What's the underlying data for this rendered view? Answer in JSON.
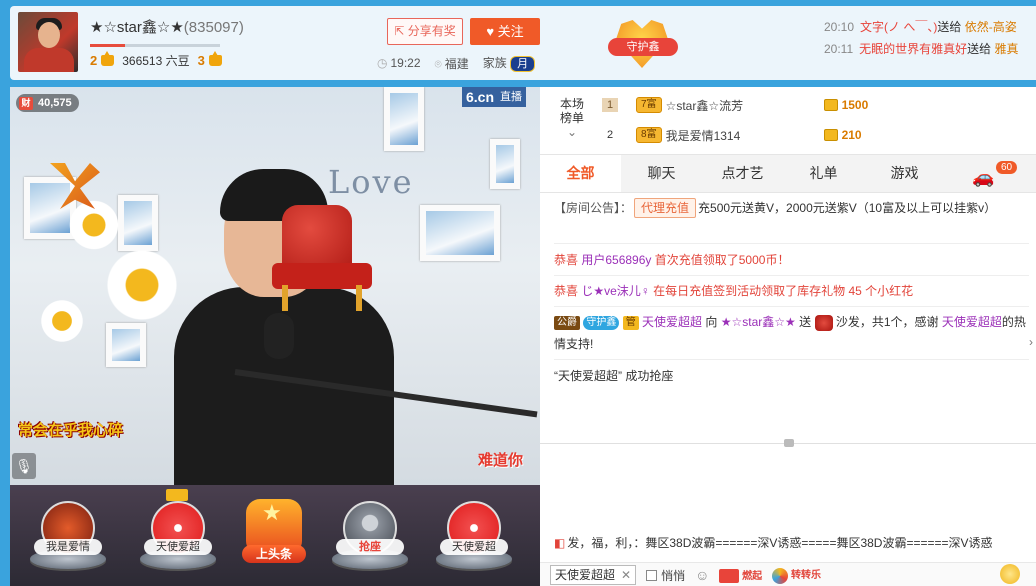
{
  "header": {
    "host_name": "★☆star鑫☆★",
    "host_id": "(835097)",
    "level_progress": 0.27,
    "level_left": "2",
    "beans": "366513 六豆",
    "level_right": "3",
    "share_label": "分享有奖",
    "follow_label": "关注",
    "time": "19:22",
    "location": "福建",
    "family_label": "家族",
    "family_badge": "月",
    "guard_label": "守护鑫"
  },
  "gift_log": [
    {
      "time": "20:10",
      "user": "文字(ノ へ￣、)",
      "action": "送给",
      "target": "依然-高姿"
    },
    {
      "time": "20:11",
      "user": "无眠的世界有雅真好",
      "action": "送给",
      "target": "雅真"
    }
  ],
  "video": {
    "wealth": "40,575",
    "wealth_tag": "财",
    "site": "6.cn",
    "live": "直播",
    "wall_text": "Love",
    "caption_left": "常会在乎我心碎",
    "caption_right": "难道你"
  },
  "seats": [
    {
      "label": "我是爱情"
    },
    {
      "label": "天使爱超"
    },
    {
      "label": "上头条"
    },
    {
      "label": "抢座"
    },
    {
      "label": "天使爱超"
    }
  ],
  "rank": {
    "title_line1": "本场",
    "title_line2": "榜单",
    "rows": [
      {
        "num": "1",
        "tag": "7富",
        "name": "☆star鑫☆流芳",
        "coins": "1500"
      },
      {
        "num": "2",
        "tag": "8富",
        "name": "我是爱情1314",
        "coins": "210"
      }
    ]
  },
  "tabs": [
    "全部",
    "聊天",
    "点才艺",
    "礼单",
    "游戏"
  ],
  "car_badge": "60",
  "chat": {
    "notice_prefix": "【房间公告】：",
    "notice_chip": "代理充值",
    "notice_text": "充500元送黄V，2000元送紫V（10富及以上可以挂紫v）",
    "congrats1_label": "恭喜",
    "congrats1_user": "用户656896y",
    "congrats1_text": "首次充值领取了5000币！",
    "congrats2_label": "恭喜",
    "congrats2_user": "じ★ve沫儿♀",
    "congrats2_text": "在每日充值签到活动领取了库存礼物 45 个小红花",
    "sofa_tag1": "公爵",
    "sofa_tag2": "守护鑫",
    "sofa_tag3": "管",
    "sofa_user": "天使爱超超",
    "sofa_to": "向",
    "sofa_host": "★☆star鑫☆★",
    "sofa_send": "送",
    "sofa_text": "沙发，共1个，感谢",
    "sofa_thanks_user": "天使爱超超",
    "sofa_tail": "的热情支持!",
    "seat_msg": "“天使爱超超” 成功抢座"
  },
  "ticker": "发，福，利，：舞区38D波霸======深V诱惑=====舞区38D波霸======深V诱惑",
  "bottom": {
    "target": "天使爱超超",
    "whisper": "悄悄",
    "promo1": "燃起",
    "promo2": "转转乐"
  }
}
